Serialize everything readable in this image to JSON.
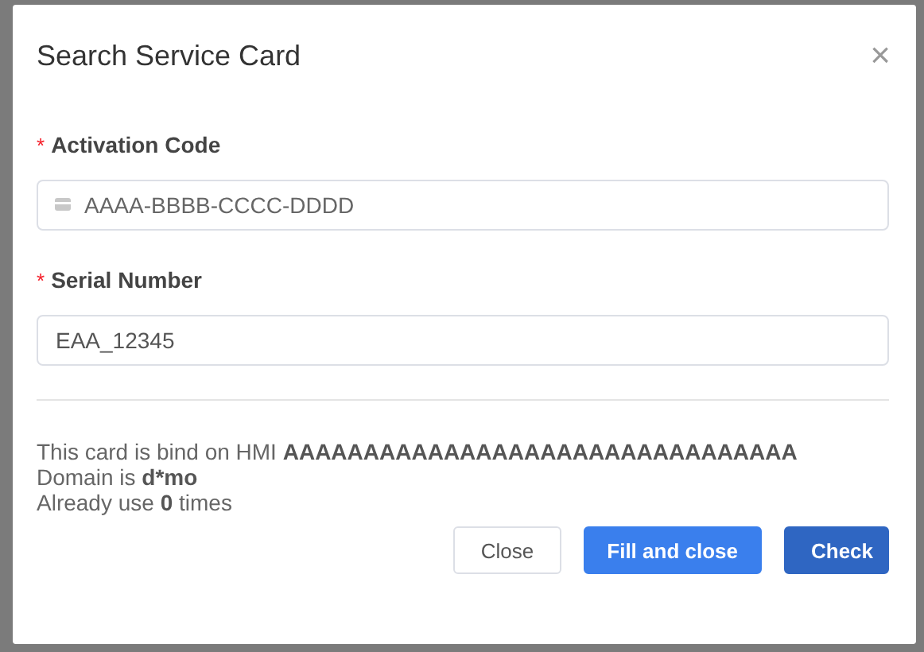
{
  "dialog": {
    "title": "Search Service Card",
    "close": "×"
  },
  "fields": [
    {
      "label": "Activation Code",
      "required_mark": "*",
      "placeholder": "AAAA-BBBB-CCCC-DDDD",
      "kind": "card"
    },
    {
      "label": "Serial Number",
      "required_mark": "*",
      "value": "EAA_12345",
      "kind": "plain"
    }
  ],
  "info": [
    "This card is bind on HMI **AAAAAAAAAAAAAAAAAAAAAAAAAAAAAAAA**",
    "Domain is **d*mo**",
    "Already use **0** times"
  ],
  "buttons": [
    {
      "label": "Close",
      "kind": "default"
    },
    {
      "label": "Fill and close",
      "kind": "primary"
    },
    {
      "label": "Check",
      "kind": "dark"
    }
  ]
}
